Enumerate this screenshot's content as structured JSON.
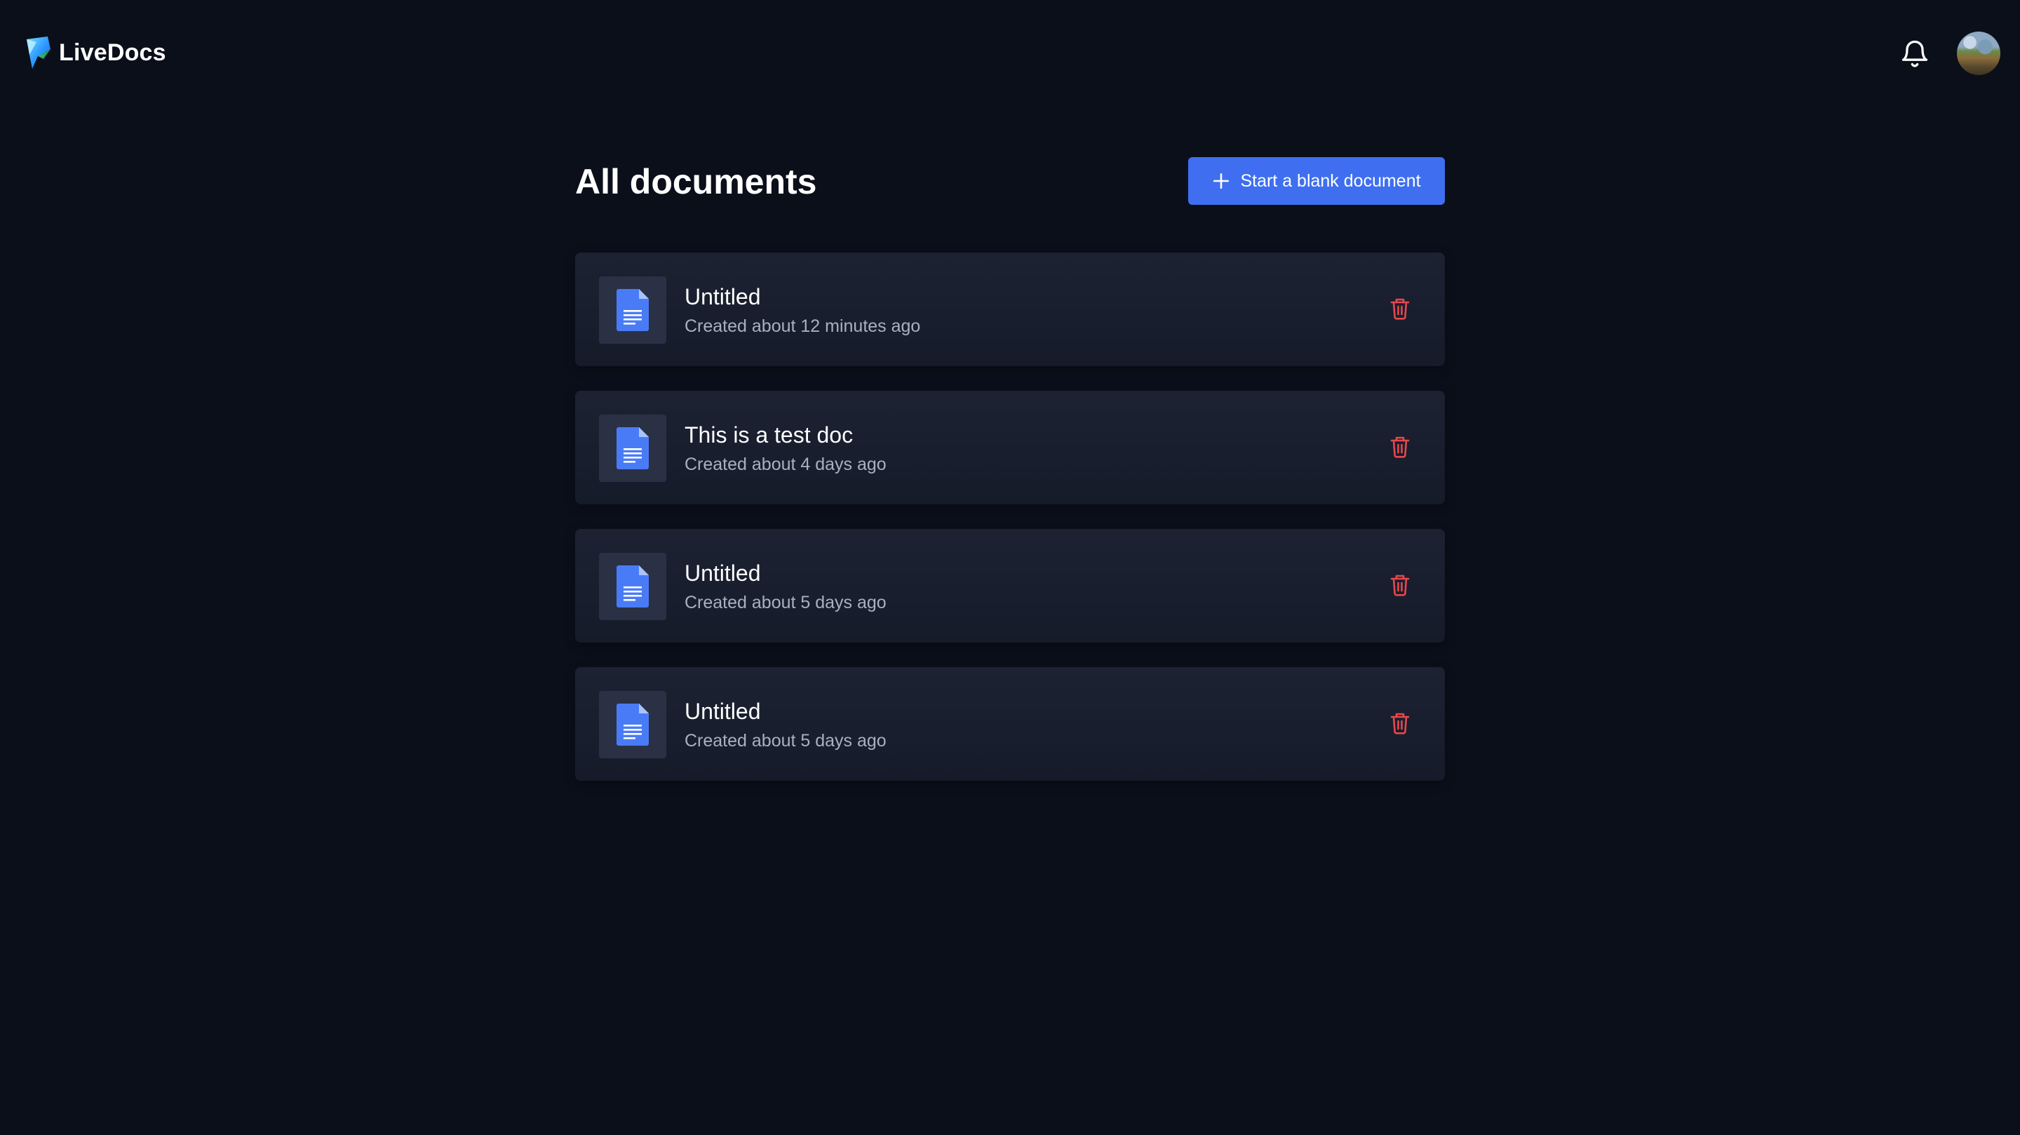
{
  "app": {
    "name": "LiveDocs",
    "logo_icon": "livedocs-logo-icon"
  },
  "header": {
    "notifications_icon": "bell-icon",
    "avatar_label": "user-avatar"
  },
  "main": {
    "title": "All documents",
    "new_document_button": {
      "label": "Start a blank document",
      "icon": "plus-icon"
    }
  },
  "documents": [
    {
      "title": "Untitled",
      "meta": "Created about 12 minutes ago",
      "icon": "document-icon",
      "delete_icon": "trash-icon"
    },
    {
      "title": "This is a test doc",
      "meta": "Created about 4 days ago",
      "icon": "document-icon",
      "delete_icon": "trash-icon"
    },
    {
      "title": "Untitled",
      "meta": "Created about 5 days ago",
      "icon": "document-icon",
      "delete_icon": "trash-icon"
    },
    {
      "title": "Untitled",
      "meta": "Created about 5 days ago",
      "icon": "document-icon",
      "delete_icon": "trash-icon"
    }
  ],
  "colors": {
    "background": "#0b0f1a",
    "card": "#1a2030",
    "accent": "#3f6ff0",
    "doc_icon": "#4a7bf7",
    "delete": "#e5484d",
    "muted_text": "#a9b0bf"
  }
}
